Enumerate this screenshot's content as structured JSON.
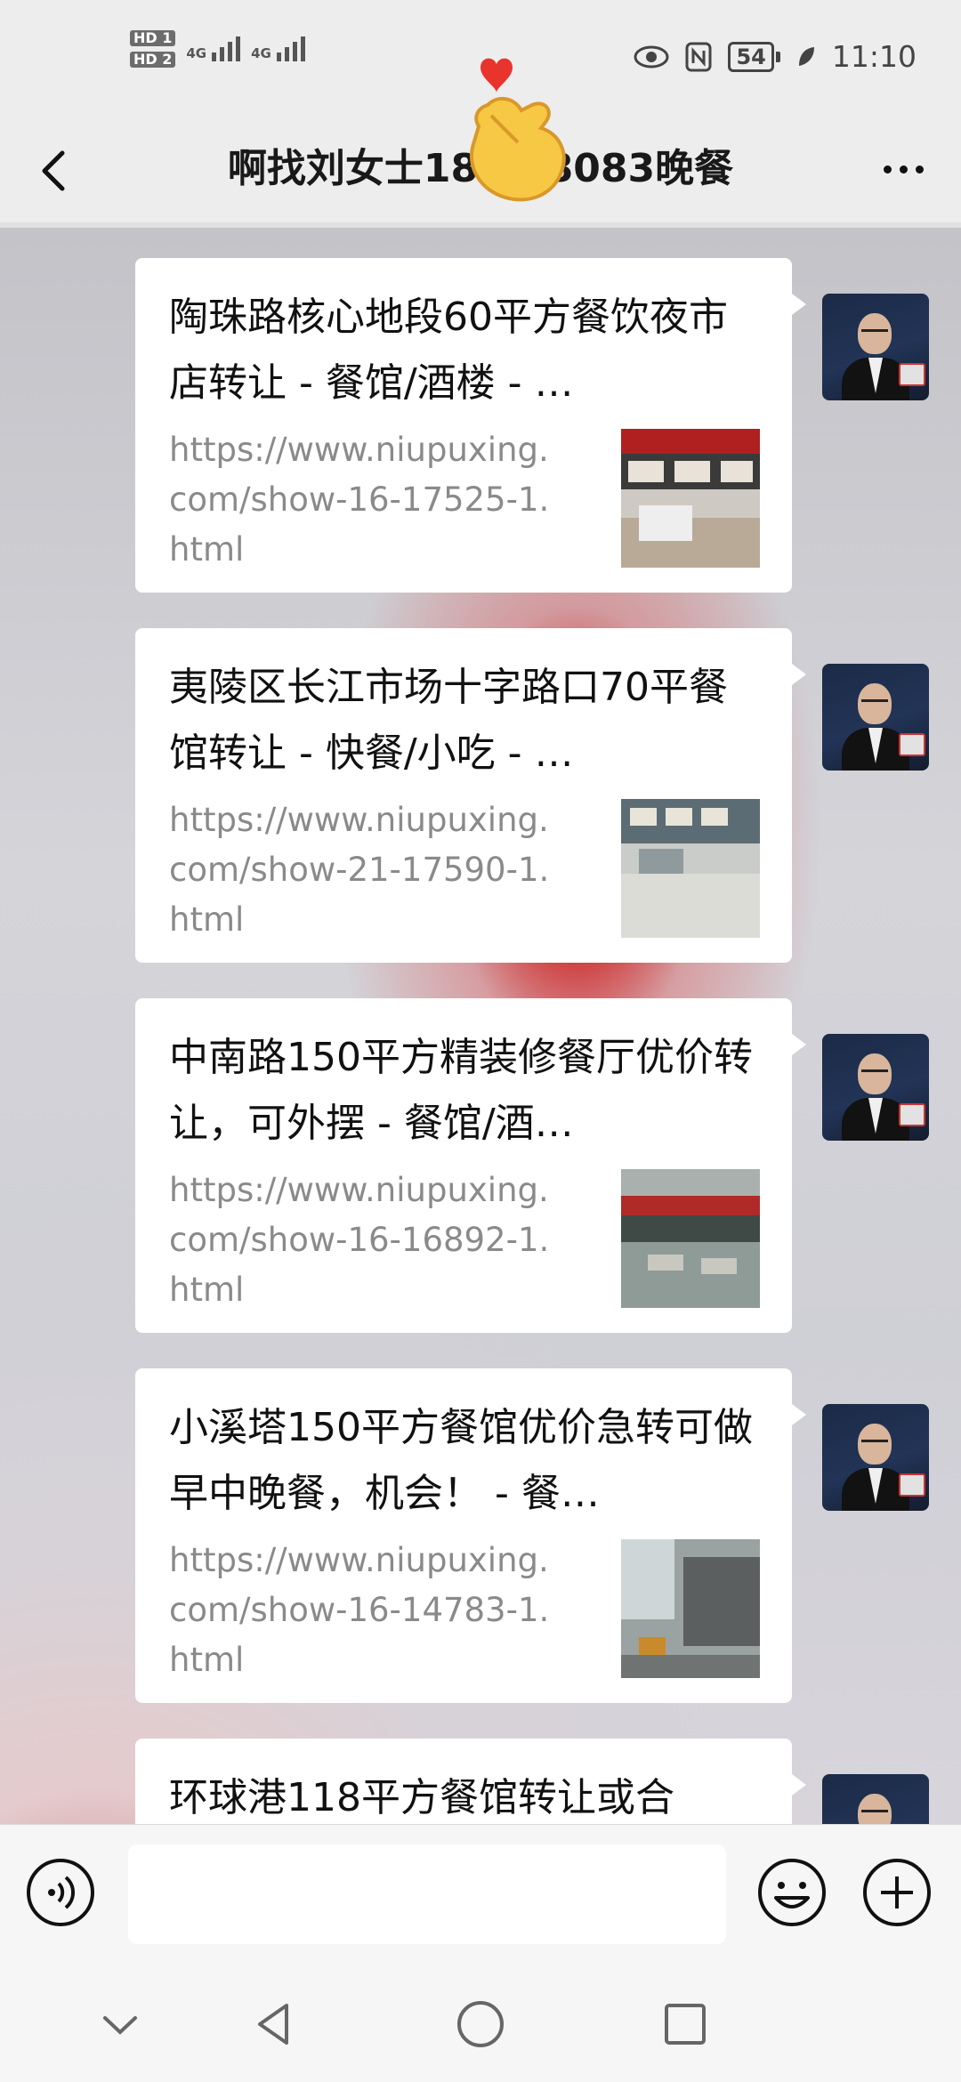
{
  "status_bar": {
    "hd1": "HD 1",
    "hd2": "HD 2",
    "sim1": "4G",
    "sim2": "4G",
    "battery": "54",
    "time": "11:10"
  },
  "header": {
    "title": "啊找刘女士18      258083晚餐"
  },
  "messages": [
    {
      "title": "陶珠路核心地段60平方餐饮夜市店转让 - 餐馆/酒楼 - …",
      "url": "https://www.niupuxing.com/show-16-17525-1.html"
    },
    {
      "title": "夷陵区长江市场十字路口70平餐馆转让 - 快餐/小吃 - …",
      "url": "https://www.niupuxing.com/show-21-17590-1.html"
    },
    {
      "title": "中南路150平方精装修餐厅优价转让，可外摆 - 餐馆/酒…",
      "url": "https://www.niupuxing.com/show-16-16892-1.html"
    },
    {
      "title": "小溪塔150平方餐馆优价急转可做早中晚餐，机会！ - 餐…",
      "url": "https://www.niupuxing.com/show-16-14783-1.html"
    },
    {
      "title": "环球港118平方餐馆转让或合",
      "url": ""
    }
  ],
  "input": {
    "placeholder": ""
  },
  "icons": {
    "back": "back-arrow-icon",
    "more": "more-dots-icon",
    "voice": "voice-icon",
    "emoji": "emoji-icon",
    "plus": "plus-icon",
    "nav_down": "chevron-down-icon",
    "nav_back": "triangle-back-icon",
    "nav_home": "circle-home-icon",
    "nav_recent": "square-recent-icon"
  },
  "colors": {
    "background": "#ededed",
    "bubble": "#ffffff",
    "url_text": "#8a8a8a"
  }
}
